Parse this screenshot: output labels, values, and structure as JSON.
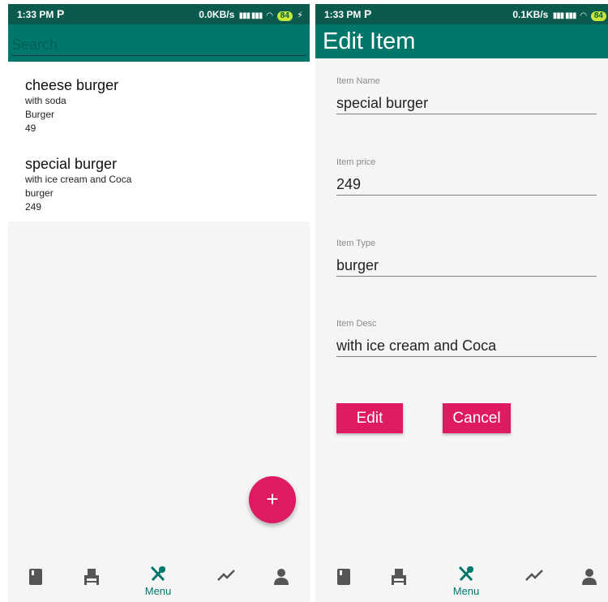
{
  "left_screen": {
    "status": {
      "time": "1:33 PM",
      "app_icon": "P",
      "speed": "0.0KB/s",
      "battery": "84"
    },
    "search": {
      "placeholder": "Search"
    },
    "items": [
      {
        "name": "cheese burger",
        "desc": "with soda",
        "type": "Burger",
        "price": "49"
      },
      {
        "name": "special burger",
        "desc": "with ice cream and Coca",
        "type": "burger",
        "price": "249"
      }
    ],
    "fab": {
      "label": "+"
    },
    "nav": {
      "menu_label": "Menu"
    }
  },
  "right_screen": {
    "status": {
      "time": "1:33 PM",
      "app_icon": "P",
      "speed": "0.1KB/s",
      "battery": "84"
    },
    "title": "Edit Item",
    "form": {
      "name_label": "Item Name",
      "name_value": "special burger",
      "price_label": "Item price",
      "price_value": "249",
      "type_label": "Item Type",
      "type_value": "burger",
      "desc_label": "Item Desc",
      "desc_value": "with ice cream and Coca"
    },
    "buttons": {
      "edit": "Edit",
      "cancel": "Cancel"
    },
    "nav": {
      "menu_label": "Menu"
    }
  },
  "colors": {
    "primary_dark": "#0a5a4d",
    "primary": "#00776a",
    "accent": "#dd1a62"
  },
  "icons": [
    "book-icon",
    "seat-icon",
    "fork-spoon-icon",
    "trending-icon",
    "person-icon",
    "wifi-icon",
    "signal-icon",
    "battery-icon"
  ]
}
